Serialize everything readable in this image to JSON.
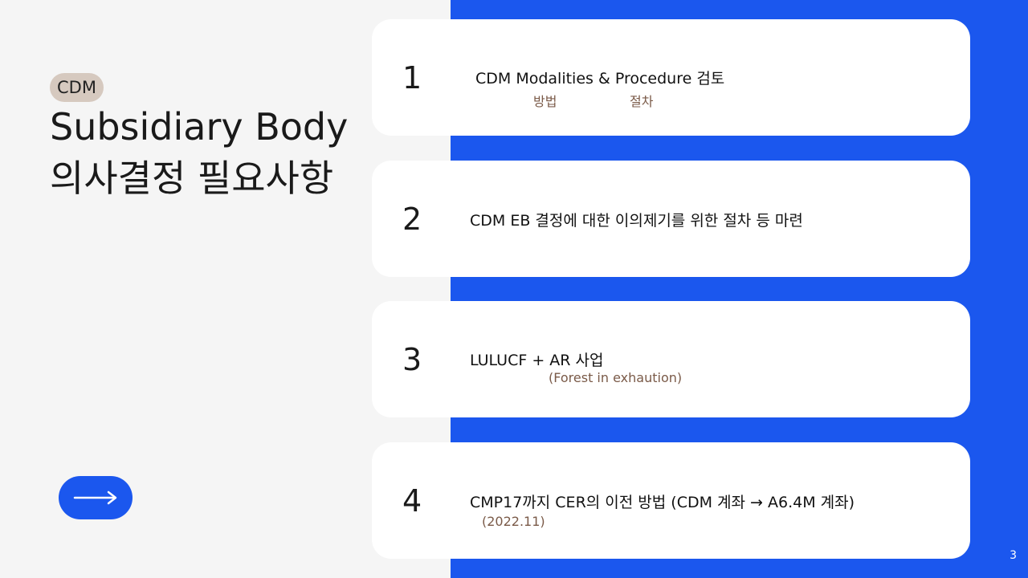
{
  "sidebar": {
    "tag": "CDM",
    "title_line1": "Subsidiary Body",
    "title_line2": "의사결정 필요사항",
    "arrow_icon": "arrow-right-icon"
  },
  "items": [
    {
      "number": "1",
      "text": "CDM Modalities & Procedure 검토",
      "sub1": "방법",
      "sub2": "절차"
    },
    {
      "number": "2",
      "text": "CDM EB 결정에 대한 이의제기를 위한 절차 등 마련"
    },
    {
      "number": "3",
      "text": "LULUCF + AR 사업",
      "sub1": "(Forest in exhaution)"
    },
    {
      "number": "4",
      "text": "CMP17까지 CER의 이전 방법 (CDM 계좌 → A6.4M 계좌)",
      "sub1": "(2022.11)"
    }
  ],
  "page_number": "3",
  "colors": {
    "accent": "#1b57ee",
    "tag_bg": "#d6c9bf",
    "sub_text": "#7a5a48"
  }
}
